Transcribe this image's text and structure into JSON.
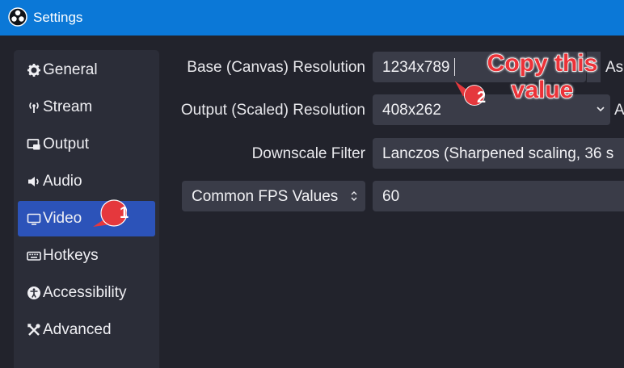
{
  "window": {
    "title": "Settings"
  },
  "sidebar": {
    "items": [
      {
        "label": "General",
        "icon": "gear-icon"
      },
      {
        "label": "Stream",
        "icon": "antenna-icon"
      },
      {
        "label": "Output",
        "icon": "output-icon"
      },
      {
        "label": "Audio",
        "icon": "speaker-icon"
      },
      {
        "label": "Video",
        "icon": "monitor-icon",
        "active": true
      },
      {
        "label": "Hotkeys",
        "icon": "keyboard-icon"
      },
      {
        "label": "Accessibility",
        "icon": "accessibility-icon"
      },
      {
        "label": "Advanced",
        "icon": "tools-icon"
      }
    ]
  },
  "video": {
    "base_label": "Base (Canvas) Resolution",
    "base_value": "1234x789",
    "base_trailing": "As",
    "output_label": "Output (Scaled) Resolution",
    "output_value": "408x262",
    "output_trailing": "A",
    "filter_label": "Downscale Filter",
    "filter_value": "Lanczos (Sharpened scaling, 36 s",
    "fps_type": "Common FPS Values",
    "fps_value": "60"
  },
  "annotations": {
    "step1": "1",
    "step2": "2",
    "note": "Copy this value",
    "color": "#ec3238"
  },
  "colors": {
    "titlebar": "#0b78d7",
    "active_item": "#2c53b9",
    "background": "#22232c"
  }
}
